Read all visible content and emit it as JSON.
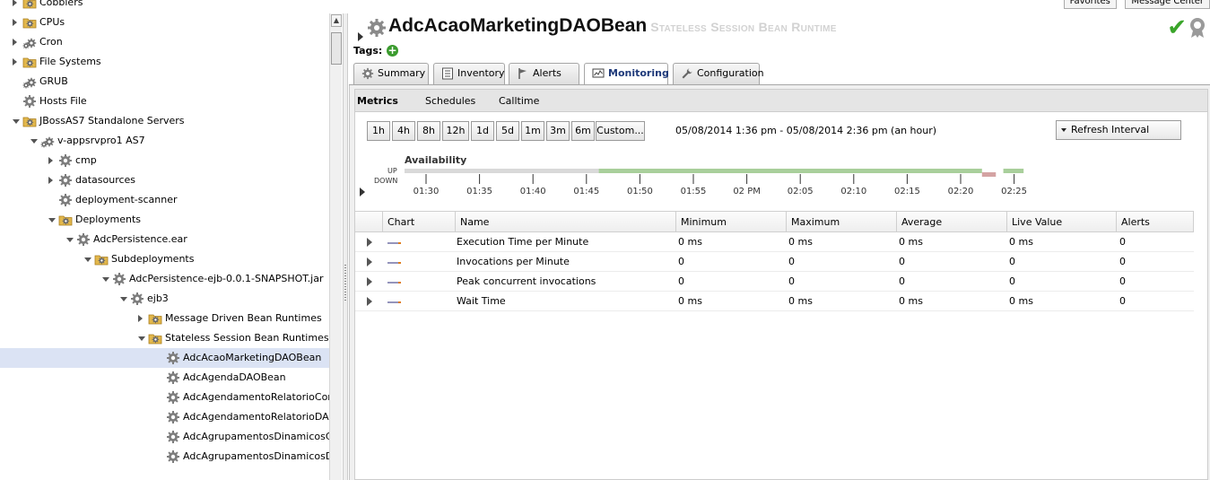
{
  "tree": {
    "items": [
      {
        "label": "Cobblers",
        "depth": 0,
        "toggle": "closed",
        "icon": "folder-gear-icon"
      },
      {
        "label": "CPUs",
        "depth": 0,
        "toggle": "closed",
        "icon": "folder-gear-icon"
      },
      {
        "label": "Cron",
        "depth": 0,
        "toggle": "closed",
        "icon": "double-gear-icon"
      },
      {
        "label": "File Systems",
        "depth": 0,
        "toggle": "closed",
        "icon": "folder-gear-icon"
      },
      {
        "label": "GRUB",
        "depth": 0,
        "toggle": "none",
        "icon": "double-gear-icon"
      },
      {
        "label": "Hosts File",
        "depth": 0,
        "toggle": "none",
        "icon": "gear-icon"
      },
      {
        "label": "JBossAS7 Standalone Servers",
        "depth": 0,
        "toggle": "open",
        "icon": "folder-gear-icon"
      },
      {
        "label": "v-appsrvpro1 AS7",
        "depth": 1,
        "toggle": "open",
        "icon": "double-gear-icon"
      },
      {
        "label": "cmp",
        "depth": 2,
        "toggle": "closed",
        "icon": "gear-icon"
      },
      {
        "label": "datasources",
        "depth": 2,
        "toggle": "closed",
        "icon": "gear-icon"
      },
      {
        "label": "deployment-scanner",
        "depth": 2,
        "toggle": "none",
        "icon": "gear-icon"
      },
      {
        "label": "Deployments",
        "depth": 2,
        "toggle": "open",
        "icon": "folder-gear-icon"
      },
      {
        "label": "AdcPersistence.ear",
        "depth": 3,
        "toggle": "open",
        "icon": "gear-icon"
      },
      {
        "label": "Subdeployments",
        "depth": 4,
        "toggle": "open",
        "icon": "folder-gear-icon"
      },
      {
        "label": "AdcPersistence-ejb-0.0.1-SNAPSHOT.jar",
        "depth": 5,
        "toggle": "open",
        "icon": "gear-icon"
      },
      {
        "label": "ejb3",
        "depth": 6,
        "toggle": "open",
        "icon": "gear-icon"
      },
      {
        "label": "Message Driven Bean Runtimes",
        "depth": 7,
        "toggle": "closed",
        "icon": "folder-gear-icon"
      },
      {
        "label": "Stateless Session Bean Runtimes",
        "depth": 7,
        "toggle": "open",
        "icon": "folder-gear-icon"
      },
      {
        "label": "AdcAcaoMarketingDAOBean",
        "depth": 8,
        "toggle": "none",
        "icon": "gear-icon",
        "selected": true
      },
      {
        "label": "AdcAgendaDAOBean",
        "depth": 8,
        "toggle": "none",
        "icon": "gear-icon"
      },
      {
        "label": "AdcAgendamentoRelatorioCombD",
        "depth": 8,
        "toggle": "none",
        "icon": "gear-icon"
      },
      {
        "label": "AdcAgendamentoRelatorioDAOBe",
        "depth": 8,
        "toggle": "none",
        "icon": "gear-icon"
      },
      {
        "label": "AdcAgrupamentosDinamicosCliDA",
        "depth": 8,
        "toggle": "none",
        "icon": "gear-icon"
      },
      {
        "label": "AdcAgrupamentosDinamicosDAOE",
        "depth": 8,
        "toggle": "none",
        "icon": "gear-icon"
      }
    ]
  },
  "header": {
    "favorites_label": "Favorites",
    "message_center_label": "Message Center",
    "title": "AdcAcaoMarketingDAOBean",
    "subtitle": "Stateless Session Bean Runtime",
    "tags_label": "Tags:",
    "tags_add": "+",
    "status_check": "✔"
  },
  "tabs": [
    {
      "label": "Summary",
      "icon": "gear-icon"
    },
    {
      "label": "Inventory",
      "icon": "inventory-icon"
    },
    {
      "label": "Alerts",
      "icon": "flag-icon"
    },
    {
      "label": "Monitoring",
      "icon": "monitor-icon",
      "active": true
    },
    {
      "label": "Configuration",
      "icon": "wrench-icon"
    }
  ],
  "subtabs": [
    {
      "label": "Metrics",
      "active": true
    },
    {
      "label": "Schedules"
    },
    {
      "label": "Calltime"
    }
  ],
  "ranges": [
    "1h",
    "4h",
    "8h",
    "12h",
    "1d",
    "5d",
    "1m",
    "3m",
    "6m",
    "Custom..."
  ],
  "range_text": "05/08/2014 1:36 pm - 05/08/2014 2:36 pm (an hour)",
  "refresh_label": "Refresh Interval",
  "availability": {
    "title": "Availability",
    "up_label": "UP",
    "down_label": "DOWN",
    "ticks": [
      "01:30",
      "01:35",
      "01:40",
      "01:45",
      "01:50",
      "01:55",
      "02 PM",
      "02:05",
      "02:10",
      "02:15",
      "02:20",
      "02:25"
    ],
    "colors": {
      "unknown": "#d9d9d9",
      "up": "#a9cf9b",
      "down": "#d4a3a3"
    },
    "segments": [
      {
        "state": "unknown",
        "from_min": 0,
        "to_min": 18.2
      },
      {
        "state": "up",
        "from_min": 18.2,
        "to_min": 54.1
      },
      {
        "state": "down",
        "from_min": 54.1,
        "to_min": 55.4
      },
      {
        "state": "up",
        "from_min": 56.1,
        "to_min": 58
      }
    ]
  },
  "metrics_table": {
    "columns": [
      "Chart",
      "Name",
      "Minimum",
      "Maximum",
      "Average",
      "Live Value",
      "Alerts"
    ],
    "rows": [
      {
        "name": "Execution Time per Minute",
        "min": "0 ms",
        "max": "0 ms",
        "avg": "0 ms",
        "live": "0 ms",
        "alerts": "0"
      },
      {
        "name": "Invocations per Minute",
        "min": "0",
        "max": "0",
        "avg": "0",
        "live": "0",
        "alerts": "0"
      },
      {
        "name": "Peak concurrent invocations",
        "min": "0",
        "max": "0",
        "avg": "0",
        "live": "0",
        "alerts": "0"
      },
      {
        "name": "Wait Time",
        "min": "0 ms",
        "max": "0 ms",
        "avg": "0 ms",
        "live": "0 ms",
        "alerts": "0"
      }
    ]
  },
  "colors": {
    "selected_row": "#dbe3f4",
    "ok_green": "#3aa52a",
    "active_tab_text": "#1f3a7a"
  }
}
